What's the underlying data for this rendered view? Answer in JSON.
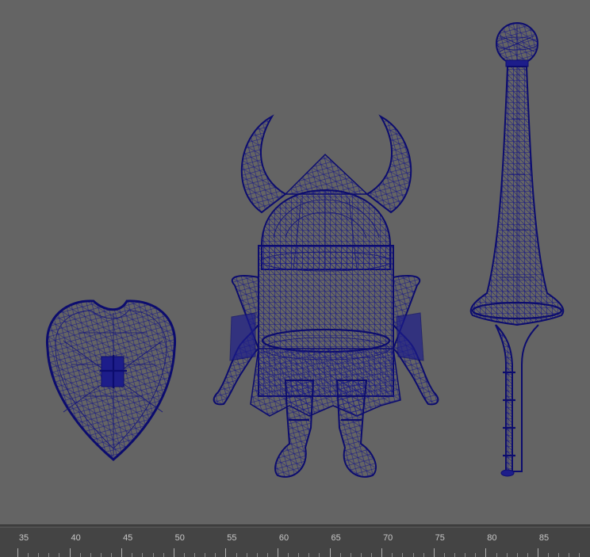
{
  "viewport": {
    "background": "#646464",
    "wire_color": "#14147a",
    "objects": [
      {
        "name": "shield",
        "icon": "shield-wireframe"
      },
      {
        "name": "knight",
        "icon": "knight-wireframe"
      },
      {
        "name": "sword",
        "icon": "sword-wireframe"
      }
    ]
  },
  "timeline": {
    "labels": [
      "35",
      "40",
      "45",
      "50",
      "55",
      "60",
      "65",
      "70",
      "75",
      "80",
      "85"
    ]
  }
}
